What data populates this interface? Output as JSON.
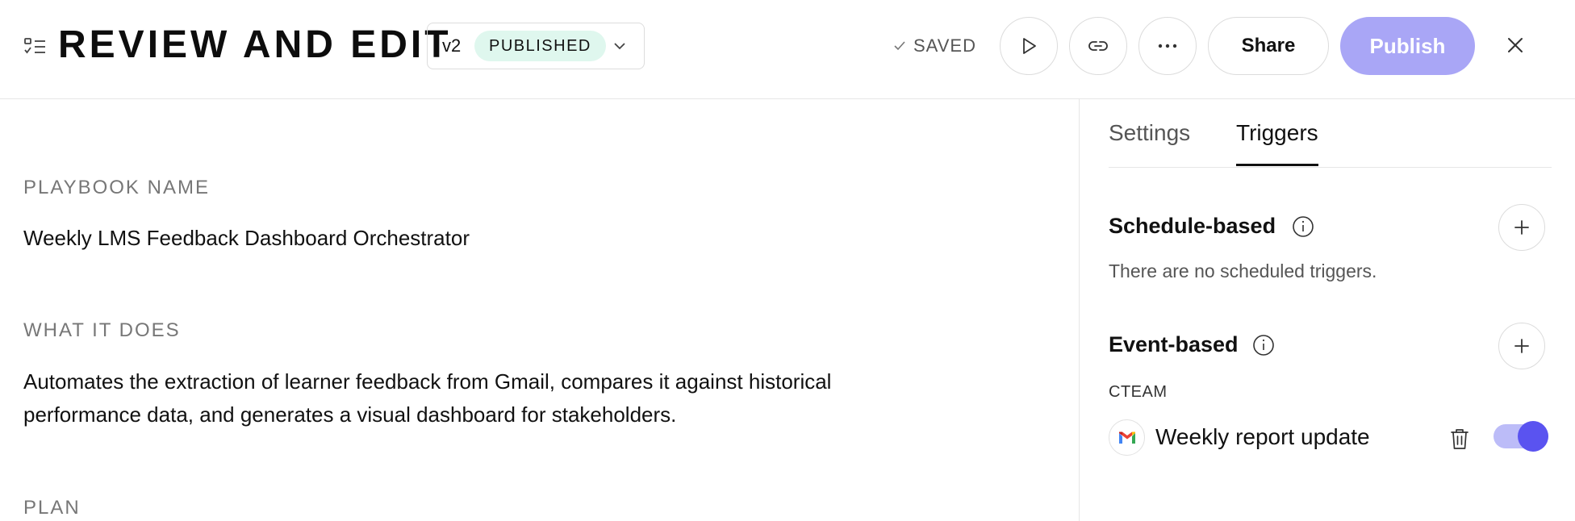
{
  "header": {
    "menu_icon": "checklist-icon",
    "title": "REVIEW AND EDIT",
    "version": {
      "label": "v2",
      "status": "PUBLISHED",
      "status_color": "#dff7ee",
      "chevron_icon": "chevron-down-icon"
    },
    "saved": {
      "icon": "check-icon",
      "label": "SAVED"
    },
    "actions": {
      "run_icon": "play-icon",
      "link_icon": "link-icon",
      "more_icon": "more-horizontal-icon"
    },
    "share_label": "Share",
    "publish_label": "Publish",
    "publish_color": "#a9a6f6",
    "close_icon": "close-icon"
  },
  "main": {
    "name_label": "PLAYBOOK NAME",
    "name_value": "Weekly LMS Feedback Dashboard Orchestrator",
    "description_label": "WHAT IT DOES",
    "description_line1": "Automates the extraction of learner feedback from Gmail, compares it against historical",
    "description_line2": "performance data, and generates a visual dashboard for stakeholders.",
    "plan_label": "PLAN"
  },
  "side_panel": {
    "tabs": [
      {
        "label": "Settings",
        "active": false
      },
      {
        "label": "Triggers",
        "active": true
      }
    ],
    "schedule": {
      "title": "Schedule-based",
      "info_icon": "info-icon",
      "add_icon": "plus-icon",
      "empty_text": "There are no scheduled triggers."
    },
    "event": {
      "title": "Event-based",
      "info_icon": "info-icon",
      "add_icon": "plus-icon",
      "account_label": "CTEAM",
      "triggers": [
        {
          "app_icon": "gmail-icon",
          "name": "Weekly report update",
          "delete_icon": "trash-icon",
          "enabled": true,
          "toggle_color": "#5a53f0"
        }
      ]
    }
  }
}
